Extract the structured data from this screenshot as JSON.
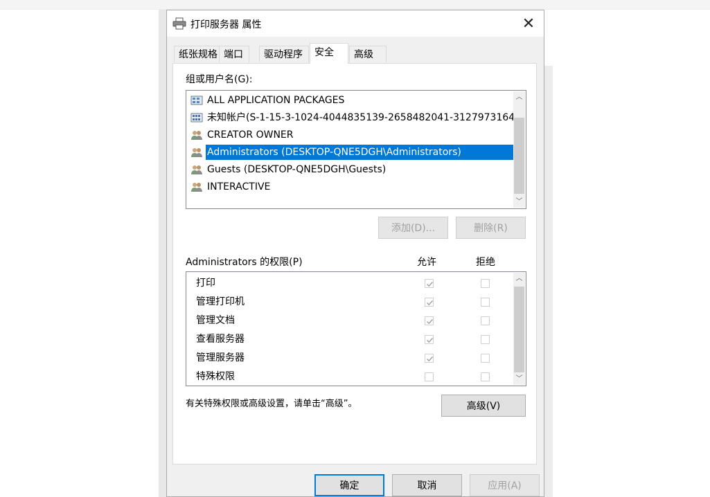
{
  "dialog": {
    "title": "打印服务器 属性",
    "close_glyph": "✕"
  },
  "tabs": [
    {
      "label": "纸张规格",
      "active": false
    },
    {
      "label": "端口",
      "active": false
    },
    {
      "label": "驱动程序",
      "active": false
    },
    {
      "label": "安全",
      "active": true
    },
    {
      "label": "高级",
      "active": false
    }
  ],
  "security": {
    "group_label": "组或用户名(G):",
    "users": [
      {
        "name": "ALL APPLICATION PACKAGES",
        "icon": "package-group-icon",
        "selected": false
      },
      {
        "name": "未知帐户(S-1-15-3-1024-4044835139-2658482041-3127973164...",
        "icon": "unknown-account-icon",
        "selected": false
      },
      {
        "name": "CREATOR OWNER",
        "icon": "users-group-icon",
        "selected": false
      },
      {
        "name": "Administrators (DESKTOP-QNE5DGH\\Administrators)",
        "icon": "users-group-icon",
        "selected": true
      },
      {
        "name": "Guests (DESKTOP-QNE5DGH\\Guests)",
        "icon": "users-group-icon",
        "selected": false
      },
      {
        "name": "INTERACTIVE",
        "icon": "users-group-icon",
        "selected": false
      }
    ],
    "add_button": "添加(D)...",
    "remove_button": "删除(R)",
    "perm_label": "Administrators 的权限(P)",
    "allow_header": "允许",
    "deny_header": "拒绝",
    "permissions": [
      {
        "name": "打印",
        "allow": true,
        "deny": false
      },
      {
        "name": "管理打印机",
        "allow": true,
        "deny": false
      },
      {
        "name": "管理文档",
        "allow": true,
        "deny": false
      },
      {
        "name": "查看服务器",
        "allow": true,
        "deny": false
      },
      {
        "name": "管理服务器",
        "allow": true,
        "deny": false
      },
      {
        "name": "特殊权限",
        "allow": false,
        "deny": false
      }
    ],
    "hint": "有关特殊权限或高级设置，请单击“高级”。",
    "advanced_button": "高级(V)"
  },
  "footer": {
    "ok": "确定",
    "cancel": "取消",
    "apply": "应用(A)"
  },
  "colors": {
    "selection": "#0078d7",
    "dialog_bg": "#f0f0f0"
  }
}
